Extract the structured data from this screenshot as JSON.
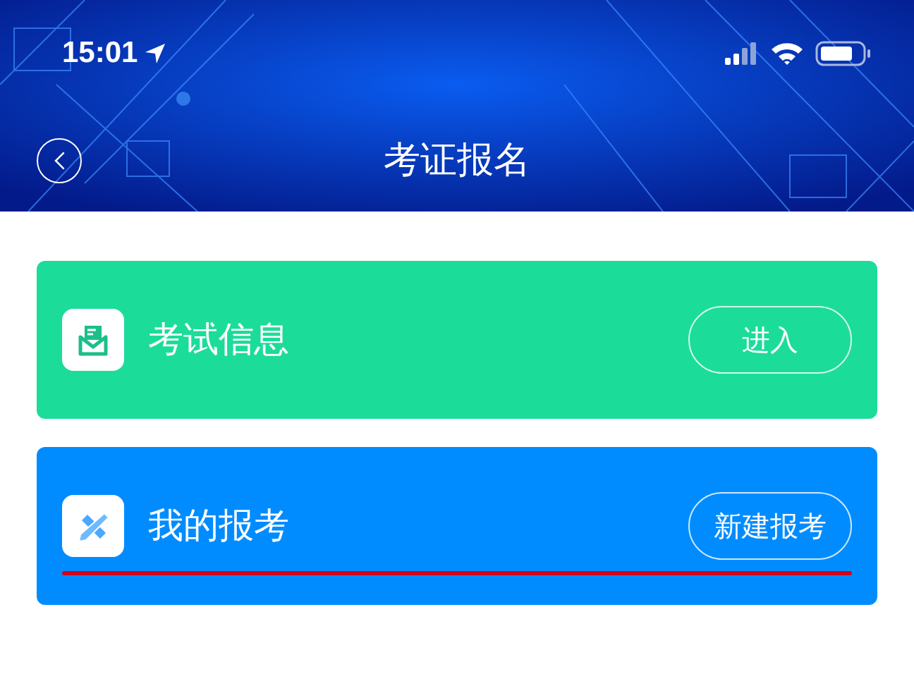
{
  "status_bar": {
    "time": "15:01"
  },
  "header": {
    "title": "考证报名"
  },
  "cards": [
    {
      "kind": "mail",
      "title": "考试信息",
      "button": "进入",
      "color": "#1cdc9a",
      "underlined": false
    },
    {
      "kind": "pencil",
      "title": "我的报考",
      "button": "新建报考",
      "color": "#008cff",
      "underlined": true
    }
  ]
}
